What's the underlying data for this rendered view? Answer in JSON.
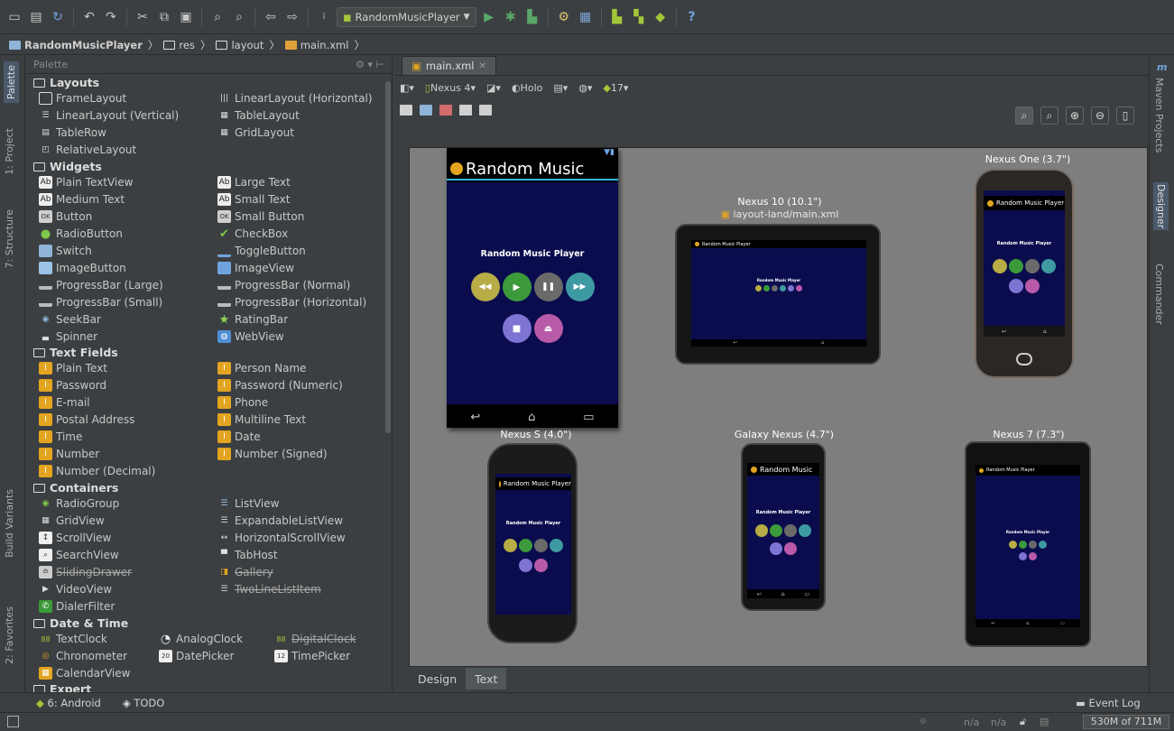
{
  "toolbar": {
    "run_config": "RandomMusicPlayer",
    "help": "?"
  },
  "breadcrumb": [
    "RandomMusicPlayer",
    "res",
    "layout",
    "main.xml"
  ],
  "left_tabs": [
    "1: Project",
    "Palette",
    "7: Structure",
    "Build Variants",
    "2: Favorites"
  ],
  "right_tabs": [
    "Maven Projects",
    "Designer",
    "Commander"
  ],
  "palette": {
    "title": "Palette",
    "categories": {
      "layouts": "Layouts",
      "widgets": "Widgets",
      "text_fields": "Text Fields",
      "containers": "Containers",
      "date_time": "Date & Time",
      "expert": "Expert"
    },
    "layouts": [
      "FrameLayout",
      "LinearLayout (Horizontal)",
      "LinearLayout (Vertical)",
      "TableLayout",
      "TableRow",
      "GridLayout",
      "RelativeLayout"
    ],
    "widgets": [
      "Plain TextView",
      "Large Text",
      "Medium Text",
      "Small Text",
      "Button",
      "Small Button",
      "RadioButton",
      "CheckBox",
      "Switch",
      "ToggleButton",
      "ImageButton",
      "ImageView",
      "ProgressBar (Large)",
      "ProgressBar (Normal)",
      "ProgressBar (Small)",
      "ProgressBar (Horizontal)",
      "SeekBar",
      "RatingBar",
      "Spinner",
      "WebView"
    ],
    "text_fields": [
      "Plain Text",
      "Person Name",
      "Password",
      "Password (Numeric)",
      "E-mail",
      "Phone",
      "Postal Address",
      "Multiline Text",
      "Time",
      "Date",
      "Number",
      "Number (Signed)",
      "Number (Decimal)"
    ],
    "containers": [
      "RadioGroup",
      "ListView",
      "GridView",
      "ExpandableListView",
      "ScrollView",
      "HorizontalScrollView",
      "SearchView",
      "TabHost",
      "SlidingDrawer",
      "Gallery",
      "VideoView",
      "TwoLineListItem",
      "DialerFilter"
    ],
    "date_time": [
      "TextClock",
      "AnalogClock",
      "DigitalClock",
      "Chronometer",
      "DatePicker",
      "TimePicker",
      "CalendarView"
    ]
  },
  "editor": {
    "file_tab": "main.xml",
    "device": "Nexus 4",
    "theme": "Holo",
    "api": "17",
    "bottom_tabs": [
      "Design",
      "Text"
    ]
  },
  "preview": {
    "app_title": "Random Music",
    "app_title_full": "Random Music Player",
    "screen_heading": "Random Music Player",
    "nexus10": "Nexus 10 (10.1\")",
    "nexus10_layout": "layout-land/main.xml",
    "nexus_one": "Nexus One (3.7\")",
    "nexus_s": "Nexus S (4.0\")",
    "galaxy_nexus": "Galaxy Nexus (4.7\")",
    "nexus7": "Nexus 7 (7.3\")"
  },
  "colors": {
    "rewind": "#b7ac45",
    "play": "#3c9a3a",
    "pause": "#6a6a6a",
    "forward": "#3e9aa2",
    "stop": "#7e74d4",
    "eject": "#b95aa8",
    "screen_bg": "#0a0c4d"
  },
  "toolwindows": {
    "android": "6: Android",
    "todo": "TODO",
    "event_log": "Event Log"
  },
  "status": {
    "na1": "n/a",
    "na2": "n/a",
    "memory": "530M of 711M"
  }
}
